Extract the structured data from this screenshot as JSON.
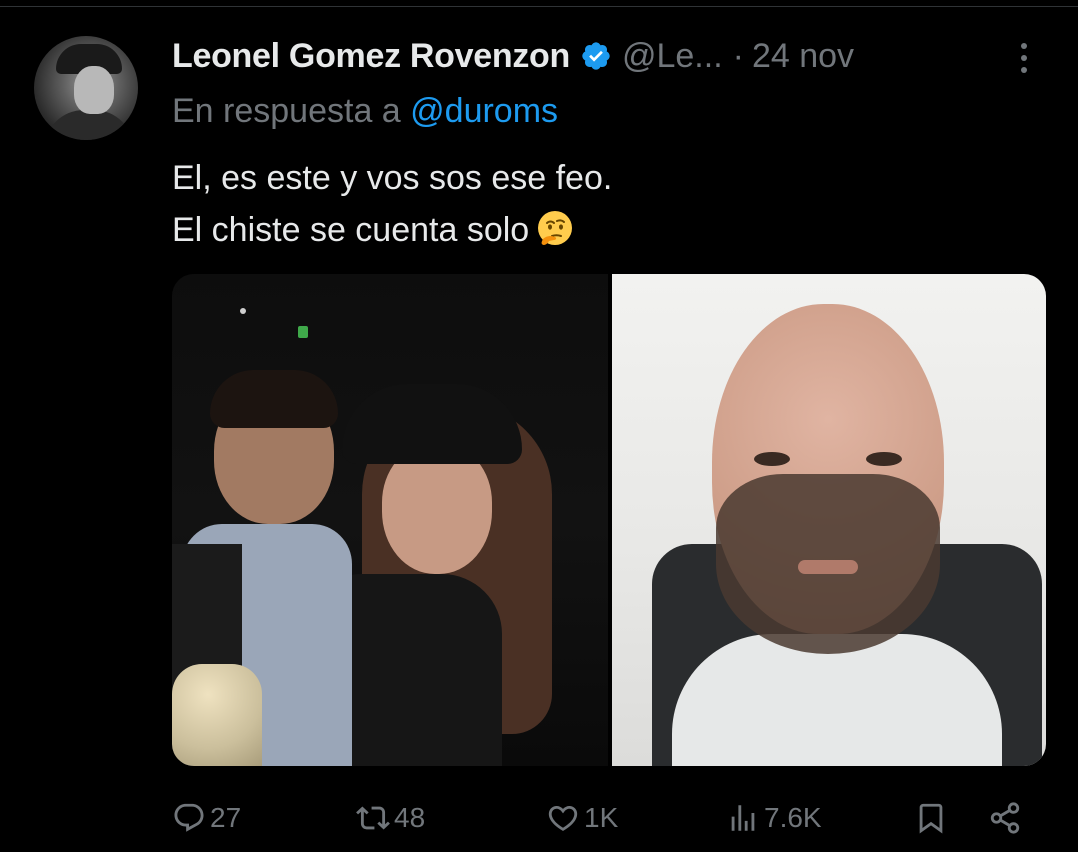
{
  "tweet": {
    "display_name": "Leonel Gomez Rovenzon",
    "verified_icon": "verified-badge-icon",
    "handle": "@Le...",
    "separator": "·",
    "date": "24 nov",
    "reply_prefix": "En respuesta a",
    "reply_to": "@duroms",
    "text_line_1": "El, es este y vos sos ese feo.",
    "text_line_2": "El chiste se cuenta solo",
    "emoji": "thinking-face-emoji"
  },
  "actions": {
    "reply_count": "27",
    "repost_count": "48",
    "like_count": "1K",
    "views_count": "7.6K"
  },
  "colors": {
    "background": "#000000",
    "text_primary": "#e7e9ea",
    "text_secondary": "#71767b",
    "accent": "#1d9bf0"
  }
}
